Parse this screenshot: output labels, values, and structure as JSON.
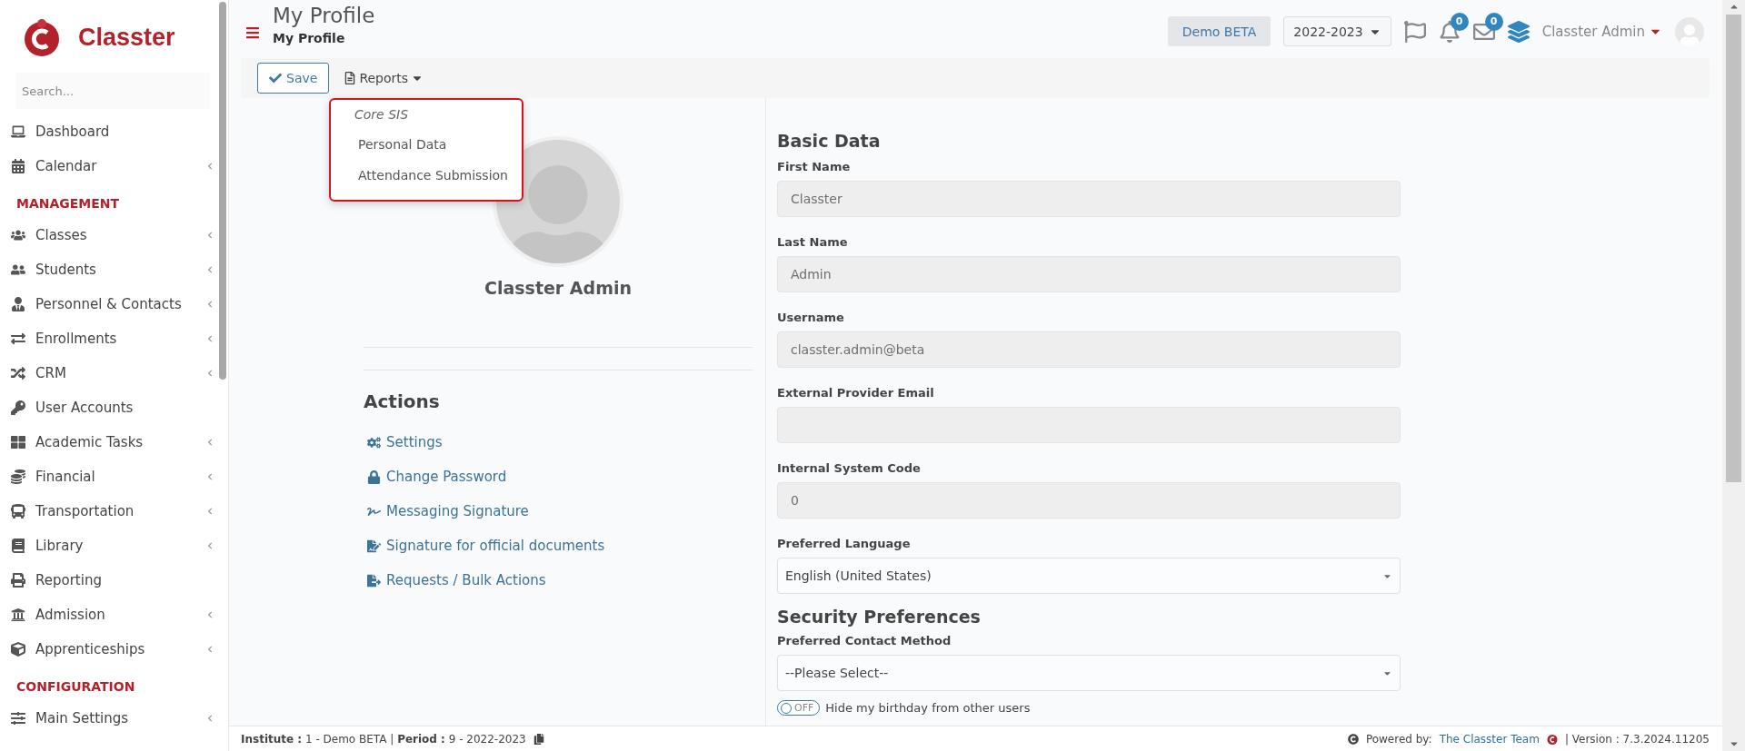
{
  "sidebar": {
    "logo_text": "Classter",
    "search": {
      "placeholder": "Search..."
    },
    "sections": [
      {
        "items": [
          {
            "label": "Dashboard",
            "has_submenu": false
          },
          {
            "label": "Calendar",
            "has_submenu": true
          }
        ]
      },
      {
        "heading": "MANAGEMENT",
        "items": [
          {
            "label": "Classes",
            "has_submenu": true
          },
          {
            "label": "Students",
            "has_submenu": true
          },
          {
            "label": "Personnel & Contacts",
            "has_submenu": true
          },
          {
            "label": "Enrollments",
            "has_submenu": true
          },
          {
            "label": "CRM",
            "has_submenu": true
          },
          {
            "label": "User Accounts",
            "has_submenu": false
          },
          {
            "label": "Academic Tasks",
            "has_submenu": true
          },
          {
            "label": "Financial",
            "has_submenu": true
          },
          {
            "label": "Transportation",
            "has_submenu": true
          },
          {
            "label": "Library",
            "has_submenu": true
          },
          {
            "label": "Reporting",
            "has_submenu": false
          },
          {
            "label": "Admission",
            "has_submenu": true
          },
          {
            "label": "Apprenticeships",
            "has_submenu": true
          }
        ]
      },
      {
        "heading": "CONFIGURATION",
        "items": [
          {
            "label": "Main Settings",
            "has_submenu": true
          }
        ]
      }
    ]
  },
  "header": {
    "title": "My Profile",
    "breadcrumb": "My Profile",
    "institute": "Demo BETA",
    "year": "2022-2023",
    "notifications": "0",
    "messages": "0",
    "user": "Classter Admin"
  },
  "toolbar": {
    "save": "Save",
    "reports": "Reports"
  },
  "reports_menu": {
    "expanded": true,
    "group": "Core SIS",
    "items": [
      "Personal Data",
      "Attendance Submission"
    ]
  },
  "profile": {
    "name": "Classter Admin"
  },
  "actions": {
    "title": "Actions",
    "links": [
      "Settings",
      "Change Password",
      "Messaging Signature",
      "Signature for official documents",
      "Requests / Bulk Actions"
    ]
  },
  "basic_data": {
    "title": "Basic Data",
    "fields": [
      {
        "label": "First Name",
        "value": "Classter",
        "kind": "input"
      },
      {
        "label": "Last Name",
        "value": "Admin",
        "kind": "input"
      },
      {
        "label": "Username",
        "value": "classter.admin@beta",
        "kind": "input"
      },
      {
        "label": "External Provider Email",
        "kind": "input"
      },
      {
        "label": "Internal System Code",
        "value": "0",
        "kind": "input"
      },
      {
        "label": "Preferred Language",
        "value": "English (United States)",
        "kind": "select"
      }
    ]
  },
  "security": {
    "title": "Security Preferences",
    "fields": [
      {
        "label": "Preferred Contact Method",
        "value": "--Please Select--",
        "kind": "select"
      }
    ],
    "toggle": {
      "label": "Hide my birthday from other users",
      "text": "OFF",
      "on": false
    }
  },
  "footer": {
    "info": "**Institute :** 1 - Demo BETA | **Period :** 9 - 2022-2023",
    "powered_by": "Powered by:",
    "team_link": "The Classter Team",
    "version": "| Version : 7.3.2024.11205"
  }
}
